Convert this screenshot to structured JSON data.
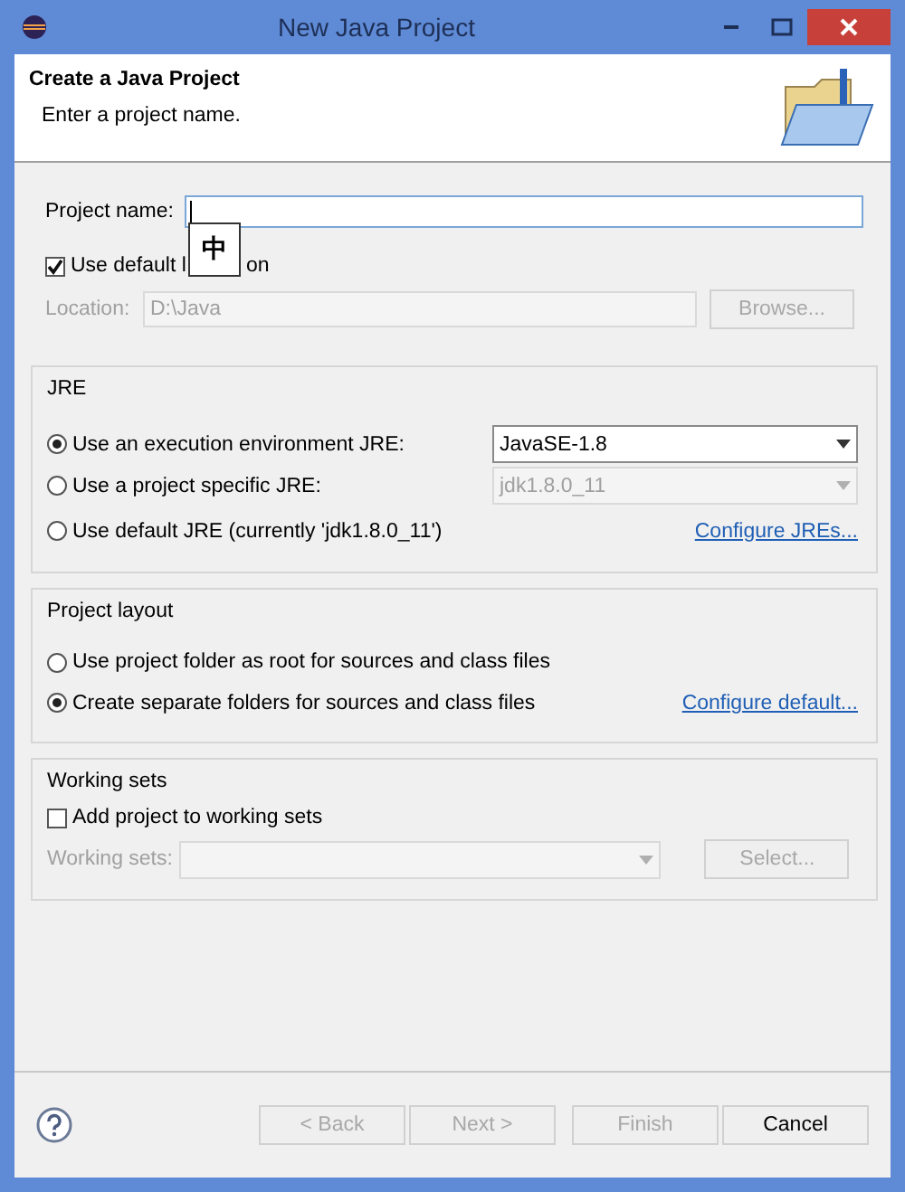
{
  "window": {
    "title": "New Java Project"
  },
  "header": {
    "title": "Create a Java Project",
    "message": "Enter a project name."
  },
  "project_name": {
    "label": "Project name:"
  },
  "ime_indicator": {
    "text": "中"
  },
  "use_default_location": {
    "label_parts": [
      "Use default l",
      "on"
    ],
    "checked": true
  },
  "location": {
    "label": "Location:",
    "value": "D:\\Java",
    "disabled": true,
    "button": "Browse..."
  },
  "jre": {
    "title": "JRE",
    "options": [
      {
        "label": "Use an execution environment JRE:",
        "selected": true,
        "kind": "combo",
        "value": "JavaSE-1.8",
        "disabled": false
      },
      {
        "label": "Use a project specific JRE:",
        "selected": false,
        "kind": "combo",
        "value": "jdk1.8.0_11",
        "disabled": true
      },
      {
        "label": "Use default JRE (currently 'jdk1.8.0_11')",
        "selected": false,
        "kind": "link",
        "link": "Configure JREs..."
      }
    ]
  },
  "project_layout": {
    "title": "Project layout",
    "options": [
      {
        "label": "Use project folder as root for sources and class files",
        "selected": false
      },
      {
        "label": "Create separate folders for sources and class files",
        "selected": true,
        "link": "Configure default..."
      }
    ]
  },
  "working_sets": {
    "title": "Working sets",
    "checkbox": {
      "label": "Add project to working sets",
      "checked": false
    },
    "label": "Working sets:",
    "disabled": true,
    "button": "Select..."
  },
  "buttons": [
    {
      "label": "< Back",
      "disabled": true
    },
    {
      "label": "Next >",
      "disabled": true
    },
    {
      "label": "Finish",
      "disabled": true
    },
    {
      "label": "Cancel",
      "disabled": false
    }
  ]
}
